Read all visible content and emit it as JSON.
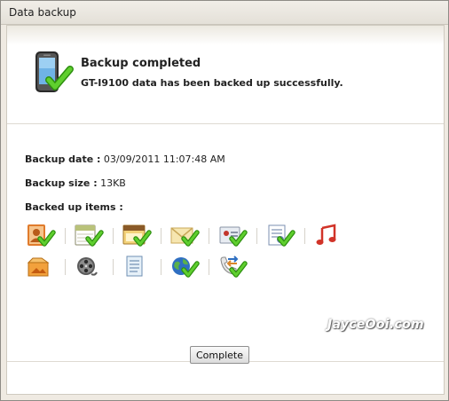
{
  "window": {
    "title": "Data backup"
  },
  "header": {
    "title": "Backup completed",
    "message": "GT-I9100 data has been backed up successfully."
  },
  "details": {
    "date_label": "Backup date :",
    "date_value": "03/09/2011 11:07:48 AM",
    "size_label": "Backup size :",
    "size_value": "13KB",
    "items_label": "Backed up items :"
  },
  "items": [
    {
      "icon": "contacts-icon",
      "checked": true
    },
    {
      "icon": "calendar-icon",
      "checked": true
    },
    {
      "icon": "memo-icon",
      "checked": true
    },
    {
      "icon": "message-icon",
      "checked": true
    },
    {
      "icon": "call-log-icon",
      "checked": true
    },
    {
      "icon": "settings-doc-icon",
      "checked": true
    },
    {
      "icon": "music-icon",
      "checked": false
    },
    {
      "icon": "photo-icon",
      "checked": false
    },
    {
      "icon": "video-icon",
      "checked": false
    },
    {
      "icon": "document-icon",
      "checked": false
    },
    {
      "icon": "internet-icon",
      "checked": true
    },
    {
      "icon": "phone-transfer-icon",
      "checked": true
    }
  ],
  "watermark": "JayceOoi.com",
  "footer": {
    "complete_label": "Complete"
  },
  "colors": {
    "check_green": "#3aa818",
    "panel_bg": "#ffffff",
    "window_bg": "#efeae2"
  }
}
